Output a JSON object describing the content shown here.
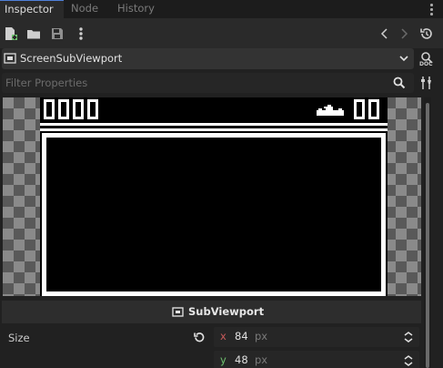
{
  "tabs": [
    {
      "label": "Inspector",
      "active": true
    },
    {
      "label": "Node",
      "active": false
    },
    {
      "label": "History",
      "active": false
    }
  ],
  "toolbar": {
    "icons": [
      "new-resource-icon",
      "open-folder-icon",
      "save-icon",
      "more-icon",
      "history-back-icon",
      "history-forward-icon",
      "history-icon"
    ]
  },
  "selector": {
    "label": "ScreenSubViewport",
    "icon": "subviewport-icon"
  },
  "filter": {
    "placeholder": "Filter Properties"
  },
  "preview": {
    "left_digits": 4,
    "right_digits": 2
  },
  "footer": {
    "label": "SubViewport"
  },
  "properties": {
    "size": {
      "label": "Size",
      "x": {
        "axis": "x",
        "value": "84",
        "unit": "px"
      },
      "y": {
        "axis": "y",
        "value": "48",
        "unit": "px"
      }
    }
  },
  "colors": {
    "accent": "#4f7fd8",
    "axis_x": "#c85a5a",
    "axis_y": "#6ec06e"
  }
}
